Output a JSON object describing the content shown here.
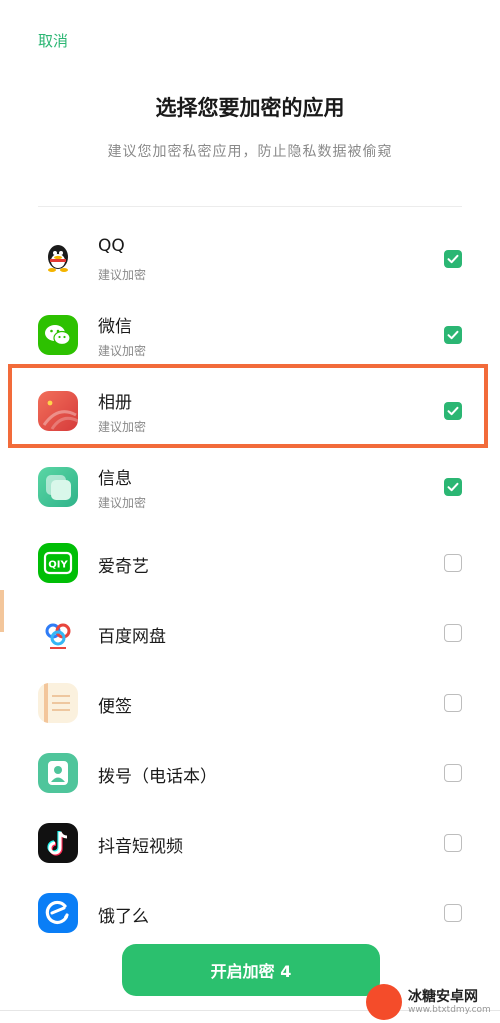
{
  "header": {
    "cancel_label": "取消",
    "title": "选择您要加密的应用",
    "subtitle": "建议您加密私密应用，防止隐私数据被偷窥"
  },
  "apps": [
    {
      "name": "QQ",
      "sub": "建议加密",
      "checked": true,
      "icon": "qq-icon"
    },
    {
      "name": "微信",
      "sub": "建议加密",
      "checked": true,
      "icon": "wechat-icon"
    },
    {
      "name": "相册",
      "sub": "建议加密",
      "checked": true,
      "icon": "gallery-icon"
    },
    {
      "name": "信息",
      "sub": "建议加密",
      "checked": true,
      "icon": "messages-icon"
    },
    {
      "name": "爱奇艺",
      "sub": "",
      "checked": false,
      "icon": "iqiyi-icon"
    },
    {
      "name": "百度网盘",
      "sub": "",
      "checked": false,
      "icon": "baidu-netdisk-icon"
    },
    {
      "name": "便签",
      "sub": "",
      "checked": false,
      "icon": "notes-icon"
    },
    {
      "name": "拨号（电话本）",
      "sub": "",
      "checked": false,
      "icon": "dialer-icon"
    },
    {
      "name": "抖音短视频",
      "sub": "",
      "checked": false,
      "icon": "douyin-icon"
    },
    {
      "name": "饿了么",
      "sub": "",
      "checked": false,
      "icon": "eleme-icon"
    }
  ],
  "footer": {
    "enable_button_label": "开启加密 4"
  },
  "watermark": {
    "text": "冰糖安卓网",
    "url": "www.btxtdmy.com"
  },
  "colors": {
    "accent": "#2bb673",
    "highlight": "#f26b3a"
  }
}
